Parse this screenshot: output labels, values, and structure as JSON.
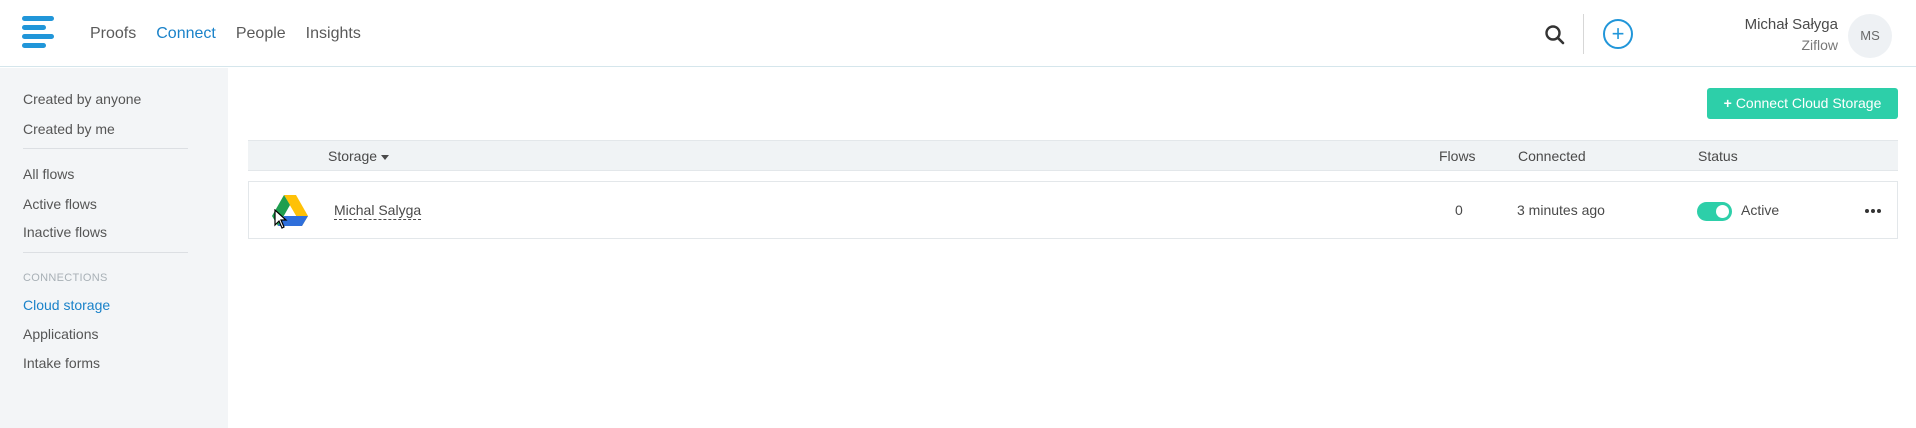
{
  "header": {
    "nav": [
      {
        "label": "Proofs",
        "active": false
      },
      {
        "label": "Connect",
        "active": true
      },
      {
        "label": "People",
        "active": false
      },
      {
        "label": "Insights",
        "active": false
      }
    ],
    "user": {
      "name": "Michał Sałyga",
      "org": "Ziflow",
      "initials": "MS"
    }
  },
  "sidebar": {
    "group1": [
      "Created by anyone",
      "Created by me"
    ],
    "group2": [
      "All flows",
      "Active flows",
      "Inactive flows"
    ],
    "connections_heading": "CONNECTIONS",
    "group3": [
      "Cloud storage",
      "Applications",
      "Intake forms"
    ],
    "active_item": "Cloud storage"
  },
  "toolbar": {
    "connect_label": "Connect Cloud Storage"
  },
  "table": {
    "headers": {
      "storage": "Storage",
      "flows": "Flows",
      "connected": "Connected",
      "status": "Status"
    },
    "rows": [
      {
        "name": "Michal Salyga",
        "flows": "0",
        "connected": "3 minutes ago",
        "status": "Active",
        "provider_icon": "google-drive-icon"
      }
    ]
  },
  "colors": {
    "accent": "#1a82c9",
    "brand": "#2196d9",
    "success": "#2dcfa9"
  }
}
